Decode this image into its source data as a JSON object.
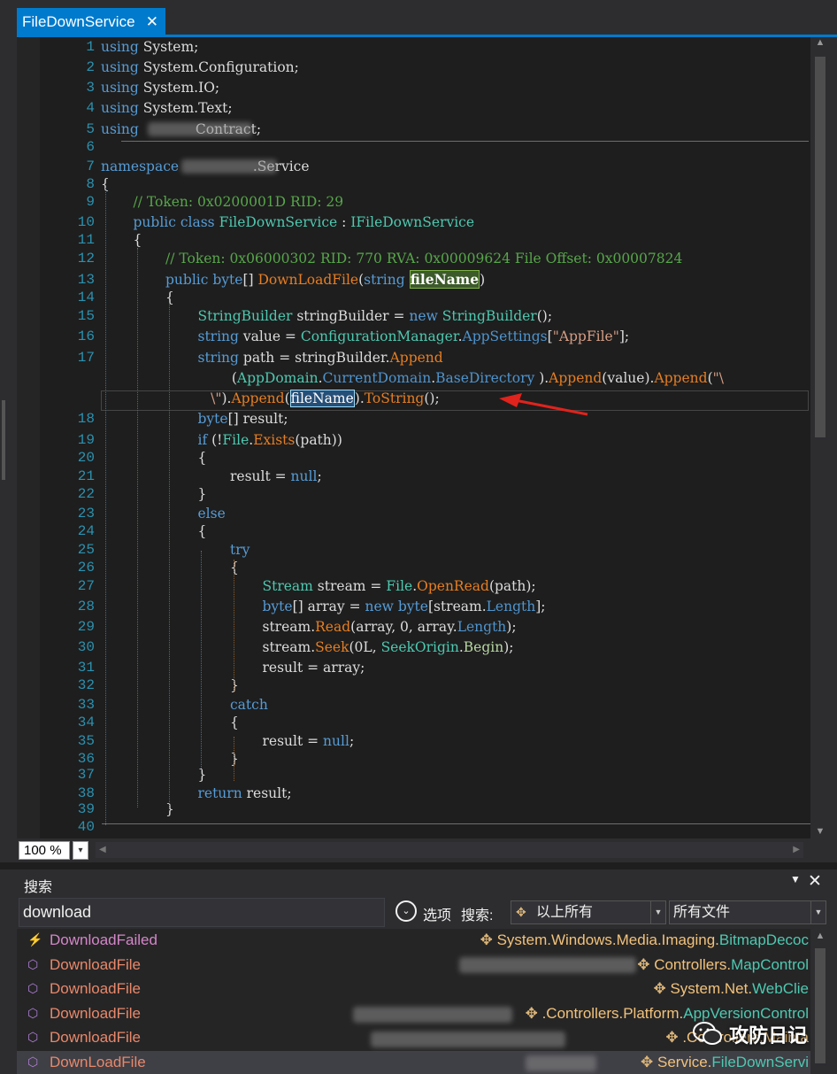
{
  "tab": {
    "title": "FileDownService",
    "close": "✕"
  },
  "code_lines": [
    {
      "n": "1",
      "parts": [
        [
          "kw",
          "using "
        ],
        [
          "",
          "System;"
        ]
      ]
    },
    {
      "n": "2",
      "parts": [
        [
          "kw",
          "using "
        ],
        [
          "",
          "System.Configuration;"
        ]
      ]
    },
    {
      "n": "3",
      "parts": [
        [
          "kw",
          "using "
        ],
        [
          "",
          "System.IO;"
        ]
      ]
    },
    {
      "n": "4",
      "parts": [
        [
          "kw",
          "using "
        ],
        [
          "",
          "System.Text;"
        ]
      ]
    },
    {
      "n": "5",
      "parts": [
        [
          "kw",
          "using "
        ],
        [
          "",
          "            Contract;"
        ]
      ]
    },
    {
      "n": "6",
      "parts": []
    },
    {
      "n": "7",
      "parts": [
        [
          "kw",
          "namespace "
        ],
        [
          "",
          "                .Service"
        ]
      ]
    },
    {
      "n": "8",
      "parts": [
        [
          "",
          "{"
        ]
      ]
    },
    {
      "n": "9",
      "parts": [
        [
          "cm",
          "// Token: 0x0200001D RID: 29"
        ]
      ]
    },
    {
      "n": "10",
      "parts": [
        [
          "kw",
          "public class "
        ],
        [
          "ty",
          "FileDownService"
        ],
        [
          "",
          " : "
        ],
        [
          "ty",
          "IFileDownService"
        ]
      ]
    },
    {
      "n": "11",
      "parts": [
        [
          "",
          "{"
        ]
      ]
    },
    {
      "n": "12",
      "parts": [
        [
          "cm",
          "// Token: 0x06000302 RID: 770 RVA: 0x00009624 File Offset: 0x00007824"
        ]
      ]
    },
    {
      "n": "13",
      "parts": [
        [
          "kw",
          "public byte"
        ],
        [
          "",
          "[] "
        ],
        [
          "mt",
          "DownLoadFile"
        ],
        [
          "",
          "("
        ],
        [
          "kw",
          "string "
        ],
        [
          "hlg",
          "fileName"
        ],
        [
          "",
          ")"
        ]
      ]
    },
    {
      "n": "14",
      "parts": [
        [
          "",
          "{"
        ]
      ]
    },
    {
      "n": "15",
      "parts": [
        [
          "ty",
          "StringBuilder"
        ],
        [
          "",
          " stringBuilder = "
        ],
        [
          "kw",
          "new "
        ],
        [
          "ty",
          "StringBuilder"
        ],
        [
          "",
          "();"
        ]
      ]
    },
    {
      "n": "16",
      "parts": [
        [
          "kw",
          "string"
        ],
        [
          "",
          " value = "
        ],
        [
          "ty",
          "ConfigurationManager"
        ],
        [
          "",
          "."
        ],
        [
          "pr",
          "AppSettings"
        ],
        [
          "",
          "["
        ],
        [
          "st",
          "\"AppFile\""
        ],
        [
          "",
          "];"
        ]
      ]
    },
    {
      "n": "17",
      "parts": [
        [
          "kw",
          "string"
        ],
        [
          "",
          " path = stringBuilder."
        ],
        [
          "mt",
          "Append"
        ]
      ]
    },
    {
      "n": "",
      "parts": [
        [
          "",
          "("
        ],
        [
          "ty",
          "AppDomain"
        ],
        [
          "",
          "."
        ],
        [
          "pr",
          "CurrentDomain"
        ],
        [
          "",
          "."
        ],
        [
          "pr",
          "BaseDirectory"
        ],
        [
          "",
          " )."
        ],
        [
          "mt",
          "Append"
        ],
        [
          "",
          "(value)."
        ],
        [
          "mt",
          "Append"
        ],
        [
          "",
          "("
        ],
        [
          "st",
          "\"\\"
        ]
      ]
    },
    {
      "n": "",
      "parts": [
        [
          "st",
          "\\\""
        ],
        [
          "",
          ")."
        ],
        [
          "mt",
          "Append"
        ],
        [
          "",
          "("
        ],
        [
          "hlb",
          "fileName"
        ],
        [
          "",
          ")."
        ],
        [
          "mt",
          "ToString"
        ],
        [
          "",
          "();"
        ]
      ]
    },
    {
      "n": "18",
      "parts": [
        [
          "kw",
          "byte"
        ],
        [
          "",
          "[] result;"
        ]
      ]
    },
    {
      "n": "19",
      "parts": [
        [
          "kw",
          "if"
        ],
        [
          "",
          " (!"
        ],
        [
          "ty",
          "File"
        ],
        [
          "",
          "."
        ],
        [
          "mt",
          "Exists"
        ],
        [
          "",
          "(path))"
        ]
      ]
    },
    {
      "n": "20",
      "parts": [
        [
          "",
          "{"
        ]
      ]
    },
    {
      "n": "21",
      "parts": [
        [
          "",
          "result = "
        ],
        [
          "kw",
          "null"
        ],
        [
          "",
          ";"
        ]
      ]
    },
    {
      "n": "22",
      "parts": [
        [
          "",
          "}"
        ]
      ]
    },
    {
      "n": "23",
      "parts": [
        [
          "kw",
          "else"
        ]
      ]
    },
    {
      "n": "24",
      "parts": [
        [
          "",
          "{"
        ]
      ]
    },
    {
      "n": "25",
      "parts": [
        [
          "kw",
          "try"
        ]
      ]
    },
    {
      "n": "26",
      "parts": [
        [
          "",
          "{"
        ]
      ]
    },
    {
      "n": "27",
      "parts": [
        [
          "ty",
          "Stream"
        ],
        [
          "",
          " stream = "
        ],
        [
          "ty",
          "File"
        ],
        [
          "",
          "."
        ],
        [
          "mt",
          "OpenRead"
        ],
        [
          "",
          "(path);"
        ]
      ]
    },
    {
      "n": "28",
      "parts": [
        [
          "kw",
          "byte"
        ],
        [
          "",
          "[] array = "
        ],
        [
          "kw",
          "new byte"
        ],
        [
          "",
          "[stream."
        ],
        [
          "pr",
          "Length"
        ],
        [
          "",
          "];"
        ]
      ]
    },
    {
      "n": "29",
      "parts": [
        [
          "",
          "stream."
        ],
        [
          "mt",
          "Read"
        ],
        [
          "",
          "(array, 0, array."
        ],
        [
          "pr",
          "Length"
        ],
        [
          "",
          ");"
        ]
      ]
    },
    {
      "n": "30",
      "parts": [
        [
          "",
          "stream."
        ],
        [
          "mt",
          "Seek"
        ],
        [
          "",
          "(0L, "
        ],
        [
          "ty",
          "SeekOrigin"
        ],
        [
          "",
          "."
        ],
        [
          "en",
          "Begin"
        ],
        [
          "",
          ");"
        ]
      ]
    },
    {
      "n": "31",
      "parts": [
        [
          "",
          "result = array;"
        ]
      ]
    },
    {
      "n": "32",
      "parts": [
        [
          "",
          "}"
        ]
      ]
    },
    {
      "n": "33",
      "parts": [
        [
          "kw",
          "catch"
        ]
      ]
    },
    {
      "n": "34",
      "parts": [
        [
          "",
          "{"
        ]
      ]
    },
    {
      "n": "35",
      "parts": [
        [
          "",
          "result = "
        ],
        [
          "kw",
          "null"
        ],
        [
          "",
          ";"
        ]
      ]
    },
    {
      "n": "36",
      "parts": [
        [
          "",
          "}"
        ]
      ]
    },
    {
      "n": "37",
      "parts": [
        [
          "",
          "}"
        ]
      ]
    },
    {
      "n": "38",
      "parts": [
        [
          "kw",
          "return"
        ],
        [
          "",
          " result;"
        ]
      ]
    },
    {
      "n": "39",
      "parts": [
        [
          "",
          "}"
        ]
      ]
    },
    {
      "n": "40",
      "parts": []
    }
  ],
  "zoom": {
    "value": "100 %",
    "dropdown": "▾"
  },
  "search_panel": {
    "title": "搜索",
    "menu": "▼",
    "close": "✕",
    "query": "download",
    "options_label": "选项",
    "scope_label": "搜索:",
    "scope_value": "以上所有",
    "files_value": "所有文件"
  },
  "results": [
    {
      "icon": "event-icon",
      "glyph": "⚡",
      "name": "DownloadFailed",
      "loc_type": "System.Windows.Media.Imaging.",
      "loc_cls": "BitmapDecoc"
    },
    {
      "icon": "method-icon",
      "glyph": "⬡",
      "name": "DownloadFile",
      "loc_type": "Controllers.",
      "loc_cls": "MapControl"
    },
    {
      "icon": "method-icon",
      "glyph": "⬡",
      "name": "DownloadFile",
      "loc_type": "System.Net.",
      "loc_cls": "WebClie"
    },
    {
      "icon": "method-icon",
      "glyph": "⬡",
      "name": "DownloadFile",
      "loc_type": ".Controllers.Platform.",
      "loc_cls": "AppVersionControl"
    },
    {
      "icon": "method-icon",
      "glyph": "⬡",
      "name": "DownloadFile",
      "loc_type": ".Controllers.Mainta",
      "loc_cls": ""
    },
    {
      "icon": "method-icon",
      "glyph": "⬡",
      "name": "DownLoadFile",
      "loc_type": "Service.",
      "loc_cls": "FileDownServi"
    }
  ],
  "watermark": "攻防日记",
  "colors": {
    "accent": "#007acc",
    "editor_bg": "#1e1e1e",
    "arrow": "#e0231c"
  }
}
